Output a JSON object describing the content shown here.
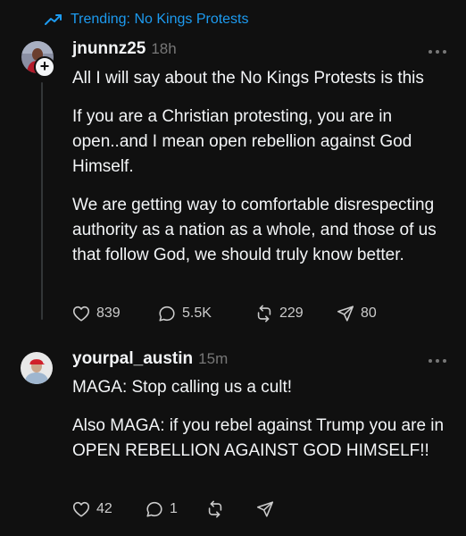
{
  "trending": {
    "label": "Trending: No Kings Protests",
    "icon": "trending-arrow-icon",
    "color": "#1d9bf0"
  },
  "posts": [
    {
      "username": "jnunnz25",
      "time": "18h",
      "paragraphs": [
        "All I will say about the No Kings Protests is this",
        "If you are a Christian protesting, you are in open..and I mean open rebellion against God Himself.",
        "We are getting way to comfortable disrespecting authority as a nation as a whole, and those of us that follow God, we should truly know better."
      ],
      "stats": {
        "likes": "839",
        "replies": "5.5K",
        "reposts": "229",
        "shares": "80"
      }
    },
    {
      "username": "yourpal_austin",
      "time": "15m",
      "paragraphs": [
        "MAGA: Stop calling us a cult!",
        "Also MAGA: if you rebel against Trump you are in OPEN REBELLION AGAINST GOD HIMSELF!!"
      ],
      "stats": {
        "likes": "42",
        "replies": "1",
        "reposts": "",
        "shares": ""
      }
    }
  ]
}
